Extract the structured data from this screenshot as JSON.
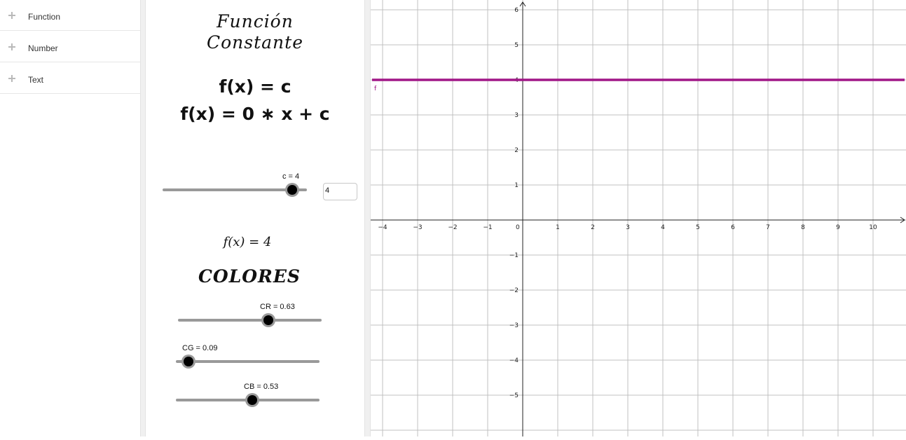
{
  "algebra": {
    "items": [
      {
        "label": "Function"
      },
      {
        "label": "Number"
      },
      {
        "label": "Text"
      }
    ]
  },
  "panel": {
    "title_line1": "Función",
    "title_line2": "Constante",
    "formula1": "f(x) = c",
    "formula2": "f(x) = 0 ∗ x + c",
    "result": "f(x) = 4",
    "colores": "COLORES",
    "sliders": {
      "c": {
        "label": "c = 4",
        "value": 4,
        "min": -5,
        "max": 5
      },
      "CR": {
        "label": "CR = 0.63",
        "value": 0.63,
        "min": 0,
        "max": 1
      },
      "CG": {
        "label": "CG = 0.09",
        "value": 0.09,
        "min": 0,
        "max": 1
      },
      "CB": {
        "label": "CB = 0.53",
        "value": 0.53,
        "min": 0,
        "max": 1
      }
    },
    "input_value": "4"
  },
  "chart_data": {
    "type": "line",
    "series": [
      {
        "name": "f",
        "x": [
          -4.3,
          10.9
        ],
        "y": [
          4,
          4
        ],
        "color": "#a11787"
      }
    ],
    "xlim": [
      -4.3,
      10.9
    ],
    "ylim": [
      -6.1,
      6.3
    ],
    "x_ticks": [
      "−4",
      "−3",
      "−2",
      "−1",
      "0",
      "1",
      "2",
      "3",
      "4",
      "5",
      "6",
      "7",
      "8",
      "9",
      "10"
    ],
    "y_ticks": [
      "6",
      "5",
      "4",
      "3",
      "2",
      "1",
      "−1",
      "−2",
      "−3",
      "−4",
      "−5"
    ],
    "grid": true,
    "curve_label": "f"
  }
}
